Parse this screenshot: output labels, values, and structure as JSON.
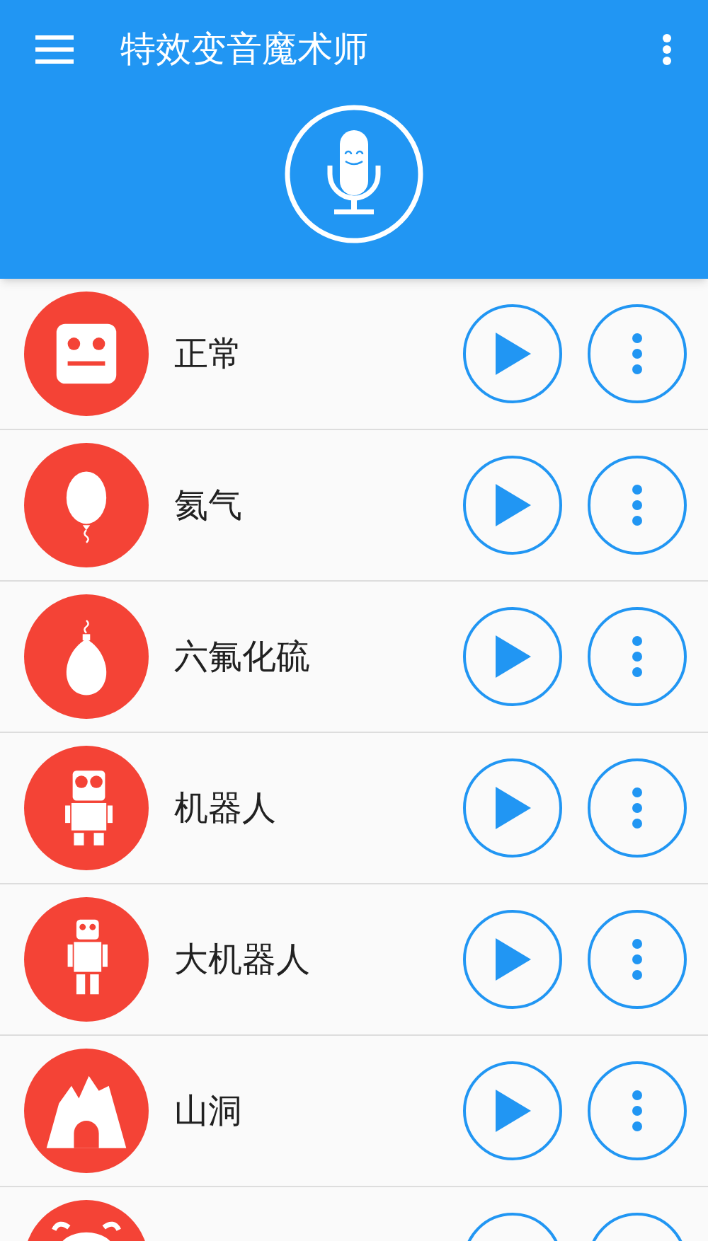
{
  "toolbar": {
    "title": "特效变音魔术师"
  },
  "effects": [
    {
      "kind": "robot-face",
      "label": "正常"
    },
    {
      "kind": "balloon",
      "label": "氦气"
    },
    {
      "kind": "heavy-balloon",
      "label": "六氟化硫"
    },
    {
      "kind": "robot",
      "label": "机器人"
    },
    {
      "kind": "tall-robot",
      "label": "大机器人"
    },
    {
      "kind": "cave",
      "label": "山洞"
    },
    {
      "kind": "bug",
      "cut_off": true
    }
  ]
}
